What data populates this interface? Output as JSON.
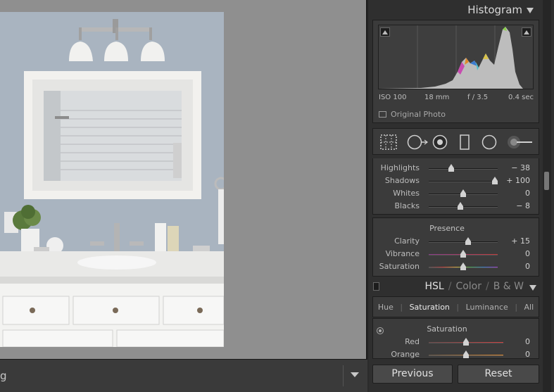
{
  "filmstrip": {
    "label": "g"
  },
  "histogram": {
    "title": "Histogram",
    "exif": {
      "iso": "ISO 100",
      "focal": "18 mm",
      "aperture": "f / 3.5",
      "shutter": "0.4 sec"
    },
    "original_photo_label": "Original Photo",
    "original_photo_checked": false
  },
  "tools": [
    "crop-overlay-icon",
    "spot-removal-icon",
    "red-eye-icon",
    "graduated-filter-icon",
    "radial-filter-icon",
    "adjustment-brush-icon"
  ],
  "tone": [
    {
      "label": "Highlights",
      "value": "− 38",
      "level": -38
    },
    {
      "label": "Shadows",
      "value": "+ 100",
      "level": 100
    },
    {
      "label": "Whites",
      "value": "0",
      "level": 0
    },
    {
      "label": "Blacks",
      "value": "− 8",
      "level": -8
    }
  ],
  "presence": {
    "title": "Presence",
    "rows": [
      {
        "label": "Clarity",
        "value": "+ 15",
        "level": 15
      },
      {
        "label": "Vibrance",
        "value": "0",
        "level": 0
      },
      {
        "label": "Saturation",
        "value": "0",
        "level": 0
      }
    ]
  },
  "hsl": {
    "tabs": {
      "hsl": "HSL",
      "color": "Color",
      "bw": "B & W",
      "sep": "/"
    },
    "subtabs": {
      "hue": "Hue",
      "saturation": "Saturation",
      "luminance": "Luminance",
      "all": "All",
      "sep": "|"
    },
    "section_title": "Saturation",
    "rows": [
      {
        "label": "Red",
        "value": "0",
        "level": 0
      },
      {
        "label": "Orange",
        "value": "0",
        "level": 0
      }
    ]
  },
  "buttons": {
    "previous": "Previous",
    "reset": "Reset"
  },
  "colors": {
    "panel": "#2f2f2f",
    "canvas": "#8f8f8f",
    "wall": "#a8b3bf"
  }
}
